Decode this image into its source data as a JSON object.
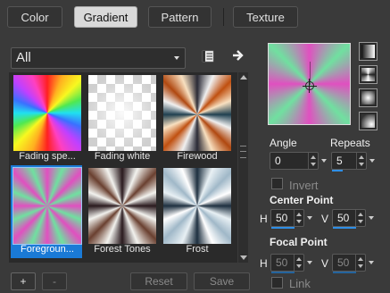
{
  "tabs": [
    {
      "label": "Color",
      "active": false
    },
    {
      "label": "Gradient",
      "active": true
    },
    {
      "label": "Pattern",
      "active": false
    },
    {
      "label": "Texture",
      "active": false
    }
  ],
  "filter": {
    "value": "All"
  },
  "gradients": [
    {
      "caption": "Fading spe...",
      "selected": false
    },
    {
      "caption": "Fading white",
      "selected": false
    },
    {
      "caption": "Firewood",
      "selected": false
    },
    {
      "caption": "Foregroun...",
      "selected": true
    },
    {
      "caption": "Forest Tones",
      "selected": false
    },
    {
      "caption": "Frost",
      "selected": false
    }
  ],
  "bottom_buttons": {
    "add": "+",
    "remove": "-",
    "reset": "Reset",
    "save": "Save"
  },
  "controls": {
    "angle_label": "Angle",
    "angle_value": "0",
    "repeats_label": "Repeats",
    "repeats_value": "5",
    "invert_label": "Invert",
    "center_point_label": "Center Point",
    "center_h_label": "H",
    "center_h_value": "50",
    "center_v_label": "V",
    "center_v_value": "50",
    "focal_point_label": "Focal Point",
    "focal_h_label": "H",
    "focal_h_value": "50",
    "focal_v_label": "V",
    "focal_v_value": "50",
    "link_label": "Link"
  },
  "gradient_styles": [
    "linear-style-icon",
    "rectangular-style-icon",
    "radial-style-icon",
    "sunburst-style-icon"
  ],
  "colors": {
    "accent": "#1a7ad6",
    "background": "#3a3a3a"
  }
}
